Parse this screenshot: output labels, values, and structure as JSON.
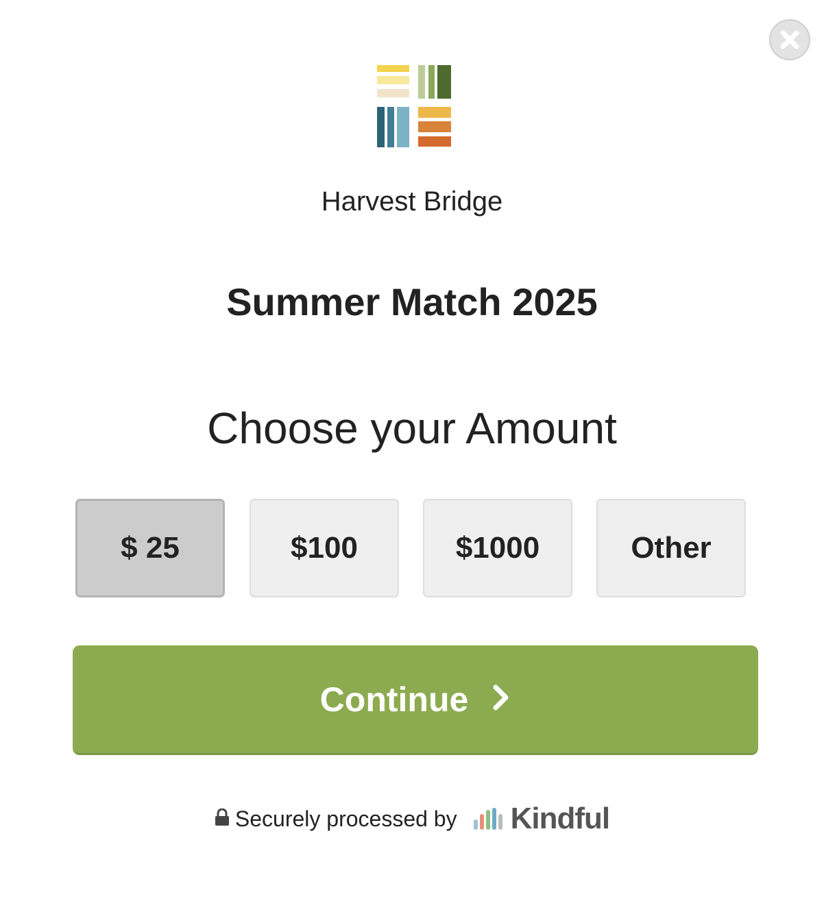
{
  "modal": {
    "close_icon": "close-icon",
    "logo_icon": "organization-logo"
  },
  "organization": {
    "name": "Harvest Bridge"
  },
  "campaign": {
    "title": "Summer Match 2025"
  },
  "amount_section": {
    "heading": "Choose your Amount",
    "options": [
      "$ 25",
      "$100",
      "$1000",
      "Other"
    ],
    "selected": "$ 25"
  },
  "continue_button": {
    "label": "Continue",
    "icon": "chevron-right-icon",
    "color": "#8cab50"
  },
  "footer": {
    "lock_icon": "lock-icon",
    "secure_text": "Securely processed by",
    "provider_name": "Kindful"
  }
}
